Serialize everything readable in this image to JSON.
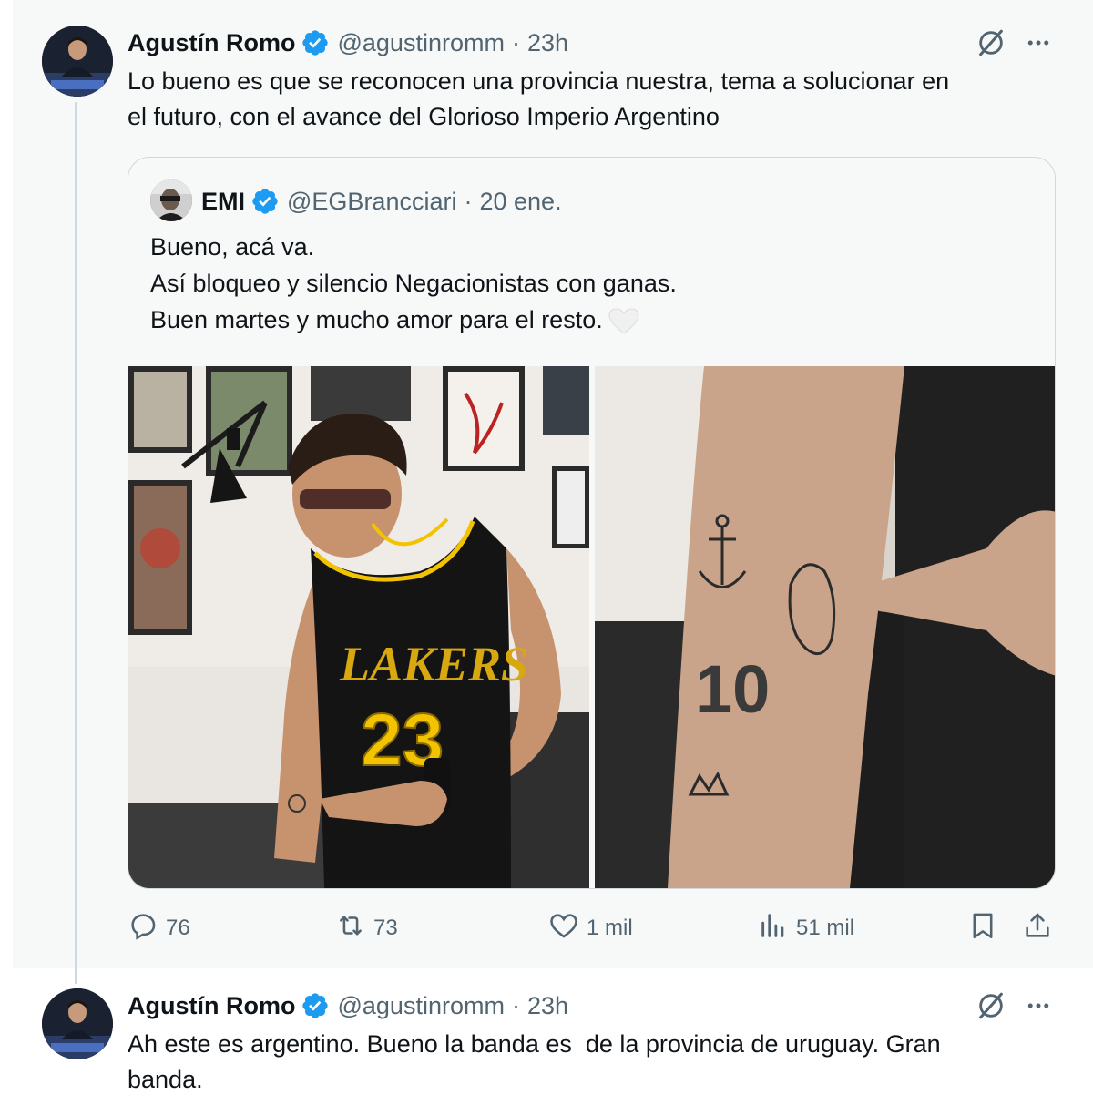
{
  "tweet1": {
    "author_name": "Agustín Romo",
    "handle": "@agustinromm",
    "separator": "·",
    "time": "23h",
    "text_line1": "Lo bueno es que se reconocen una provincia nuestra, tema a solucionar en",
    "text_line2": "el futuro, con el avance del Glorioso Imperio Argentino",
    "quote": {
      "author_name": "EMI",
      "handle": "@EGBrancciari",
      "separator": "·",
      "date": "20 ene.",
      "line1": "Bueno, acá va.",
      "line2": "Así bloqueo y silencio Negacionistas con ganas.",
      "line3": "Buen martes y mucho amor para el resto.",
      "jersey_text": "LAKERS",
      "jersey_number": "23",
      "tattoo_number": "10"
    },
    "stats": {
      "replies": "76",
      "reposts": "73",
      "likes": "1 mil",
      "views": "51 mil"
    }
  },
  "tweet2": {
    "author_name": "Agustín Romo",
    "handle": "@agustinromm",
    "separator": "·",
    "time": "23h",
    "text_line1": "Ah este es argentino. Bueno la banda es  de la provincia de uruguay. Gran",
    "text_line2": "banda."
  },
  "icons": {
    "verified": "verified-badge-icon",
    "grok": "grok-icon",
    "more": "more-dots-icon",
    "reply": "reply-icon",
    "repost": "repost-icon",
    "like": "heart-icon",
    "views": "views-icon",
    "bookmark": "bookmark-icon",
    "share": "share-icon"
  },
  "colors": {
    "verified_blue": "#1d9bf0",
    "secondary_text": "#536471",
    "background_selected": "#f7f9f9",
    "border": "#cfd9de"
  }
}
